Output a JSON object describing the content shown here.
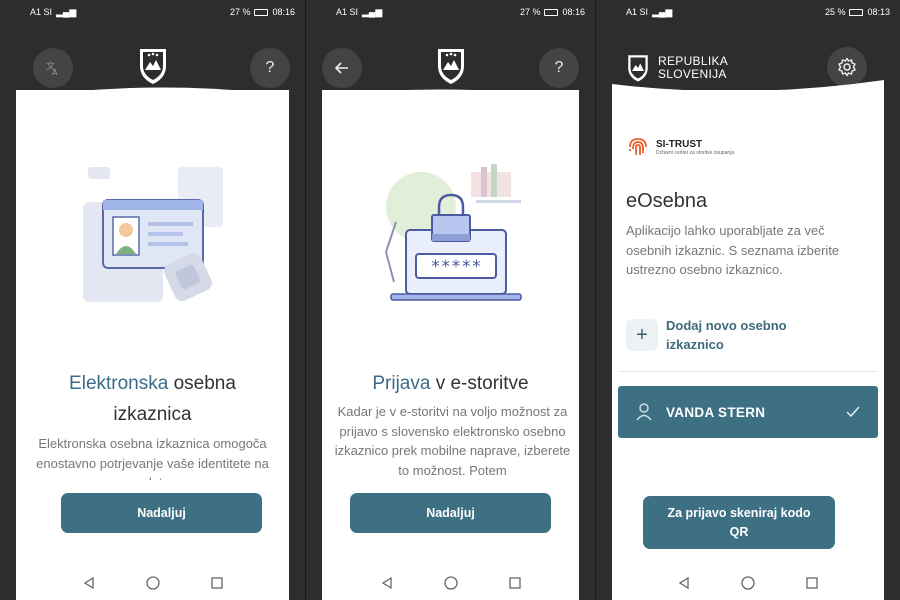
{
  "screen1": {
    "status": {
      "carrier": "A1 SI",
      "battery": "27 %",
      "time": "08:16"
    },
    "title_accent": "Elektronska",
    "title_rest": " osebna izkaznica",
    "body": "Elektronska osebna izkaznica omogoča enostavno potrjevanje vaše identitete na spletu",
    "continue_label": "Nadaljuj",
    "icons": {
      "left": "translate-icon",
      "right": "help-icon"
    }
  },
  "screen2": {
    "status": {
      "carrier": "A1 SI",
      "battery": "27 %",
      "time": "08:16"
    },
    "title_accent": "Prijava",
    "title_rest": " v e-storitve",
    "body": "Kadar je v e-storitvi na voljo možnost za prijavo s slovensko elektronsko osebno izkaznico prek mobilne naprave, izberete to možnost. Potem",
    "password_mask": "*****",
    "continue_label": "Nadaljuj",
    "icons": {
      "left": "back-arrow-icon",
      "right": "help-icon"
    }
  },
  "screen3": {
    "status": {
      "carrier": "A1 SI",
      "battery": "25 %",
      "time": "08:13"
    },
    "brand_line1": "REPUBLIKA",
    "brand_line2": "SLOVENIJA",
    "sitrust_name": "SI-TRUST",
    "sitrust_sub": "Državni center za storitve zaupanja",
    "heading": "eOsebna",
    "description": "Aplikacijo lahko uporabljate za več osebnih izkaznic. S seznama izberite ustrezno osebno izkaznico.",
    "add_label": "Dodaj novo osebno izkaznico",
    "selected_person": "VANDA STERN",
    "scan_label": "Za prijavo skeniraj kodo QR",
    "icons": {
      "right": "settings-gear-icon"
    }
  },
  "colors": {
    "accent": "#3e7083",
    "title_accent": "#3b6b8a",
    "dark_bg": "#2d2d2d"
  }
}
